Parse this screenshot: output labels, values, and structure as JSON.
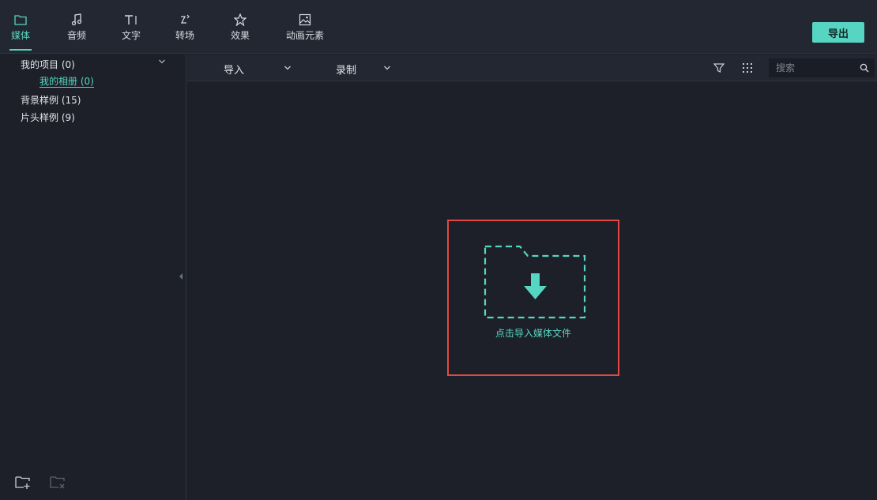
{
  "tabs": [
    {
      "label": "媒体",
      "icon": "folder-icon",
      "active": true
    },
    {
      "label": "音频",
      "icon": "music-note-icon",
      "active": false
    },
    {
      "label": "文字",
      "icon": "text-icon",
      "active": false
    },
    {
      "label": "转场",
      "icon": "transition-icon",
      "active": false
    },
    {
      "label": "效果",
      "icon": "effects-icon",
      "active": false
    },
    {
      "label": "动画元素",
      "icon": "image-icon",
      "active": false
    }
  ],
  "export_label": "导出",
  "sidebar": {
    "items": [
      {
        "label": "我的项目 (0)"
      },
      {
        "label": "我的相册 (0)"
      },
      {
        "label": "背景样例 (15)"
      },
      {
        "label": "片头样例 (9)"
      }
    ]
  },
  "toolbar": {
    "import_label": "导入",
    "record_label": "录制",
    "search_placeholder": "搜索"
  },
  "dropzone": {
    "label": "点击导入媒体文件"
  },
  "colors": {
    "accent": "#56d5c2",
    "highlight_border": "#e04a44",
    "background": "#1d2029",
    "panel": "#232732"
  }
}
